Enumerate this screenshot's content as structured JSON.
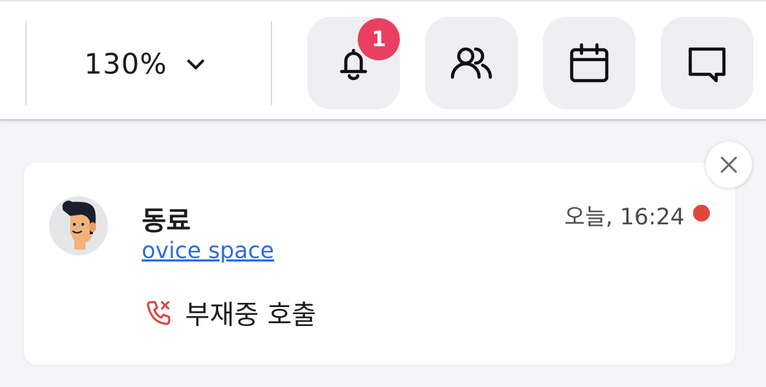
{
  "toolbar": {
    "zoom_value": "130%",
    "notification_count": "1",
    "buttons": [
      {
        "icon": "bell-icon",
        "name": "notifications"
      },
      {
        "icon": "users-icon",
        "name": "members"
      },
      {
        "icon": "calendar-icon",
        "name": "calendar"
      },
      {
        "icon": "chat-icon",
        "name": "chat"
      }
    ]
  },
  "notification": {
    "sender": "동료",
    "space": "ovice space",
    "time": "오늘, 16:24",
    "message": "부재중 호출",
    "message_icon": "missed-call-icon",
    "unread": true
  },
  "colors": {
    "badge": "#ea3f61",
    "link": "#2d6be4",
    "unread_dot": "#e0473a",
    "missed_call": "#d9473f",
    "button_bg": "#efeef2"
  }
}
